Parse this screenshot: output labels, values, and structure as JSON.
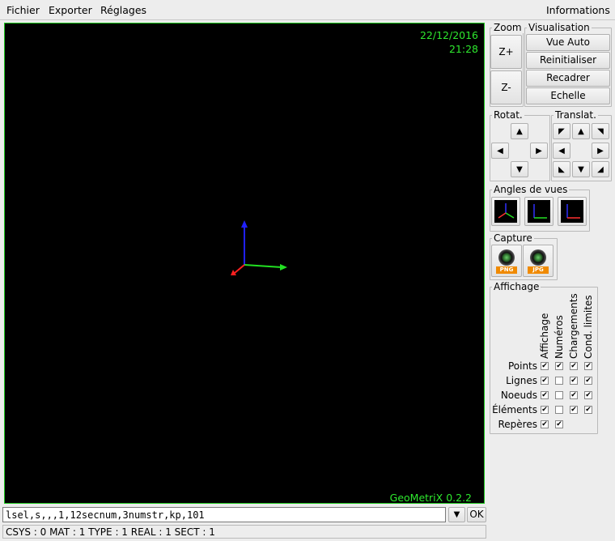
{
  "menubar": {
    "items": [
      "Fichier",
      "Exporter",
      "Réglages"
    ],
    "right_item": "Informations"
  },
  "viewport": {
    "date": "22/12/2016",
    "time": "21:28",
    "brand": "GeoMetriX 0.2.2",
    "axis_colors": {
      "x": "#22e022",
      "y": "#2020ff",
      "z": "#ff2020"
    }
  },
  "zoom": {
    "title": "Zoom",
    "zoom_in": "Z+",
    "zoom_out": "Z-"
  },
  "visualisation": {
    "title": "Visualisation",
    "buttons": [
      "Vue Auto",
      "Reinitialiser",
      "Recadrer",
      "Echelle"
    ]
  },
  "rotation": {
    "title": "Rotat."
  },
  "translation": {
    "title": "Translat."
  },
  "view_angles": {
    "title": "Angles de vues"
  },
  "capture": {
    "title": "Capture",
    "png": "PNG",
    "jpg": "JPG"
  },
  "display": {
    "title": "Affichage",
    "columns": [
      "Affichage",
      "Numéros",
      "Chargements",
      "Cond. limites"
    ],
    "rows": [
      {
        "label": "Points",
        "checks": [
          true,
          true,
          true,
          true
        ]
      },
      {
        "label": "Lignes",
        "checks": [
          true,
          false,
          true,
          true
        ]
      },
      {
        "label": "Noeuds",
        "checks": [
          true,
          false,
          true,
          true
        ]
      },
      {
        "label": "Éléments",
        "checks": [
          true,
          false,
          true,
          true
        ]
      },
      {
        "label": "Repères",
        "checks": [
          true,
          true,
          null,
          null
        ]
      }
    ]
  },
  "command": {
    "value": "lsel,s,,,1,12secnum,3numstr,kp,101",
    "ok_label": "OK"
  },
  "status": {
    "text": "CSYS : 0 MAT : 1 TYPE : 1 REAL : 1 SECT : 1"
  }
}
